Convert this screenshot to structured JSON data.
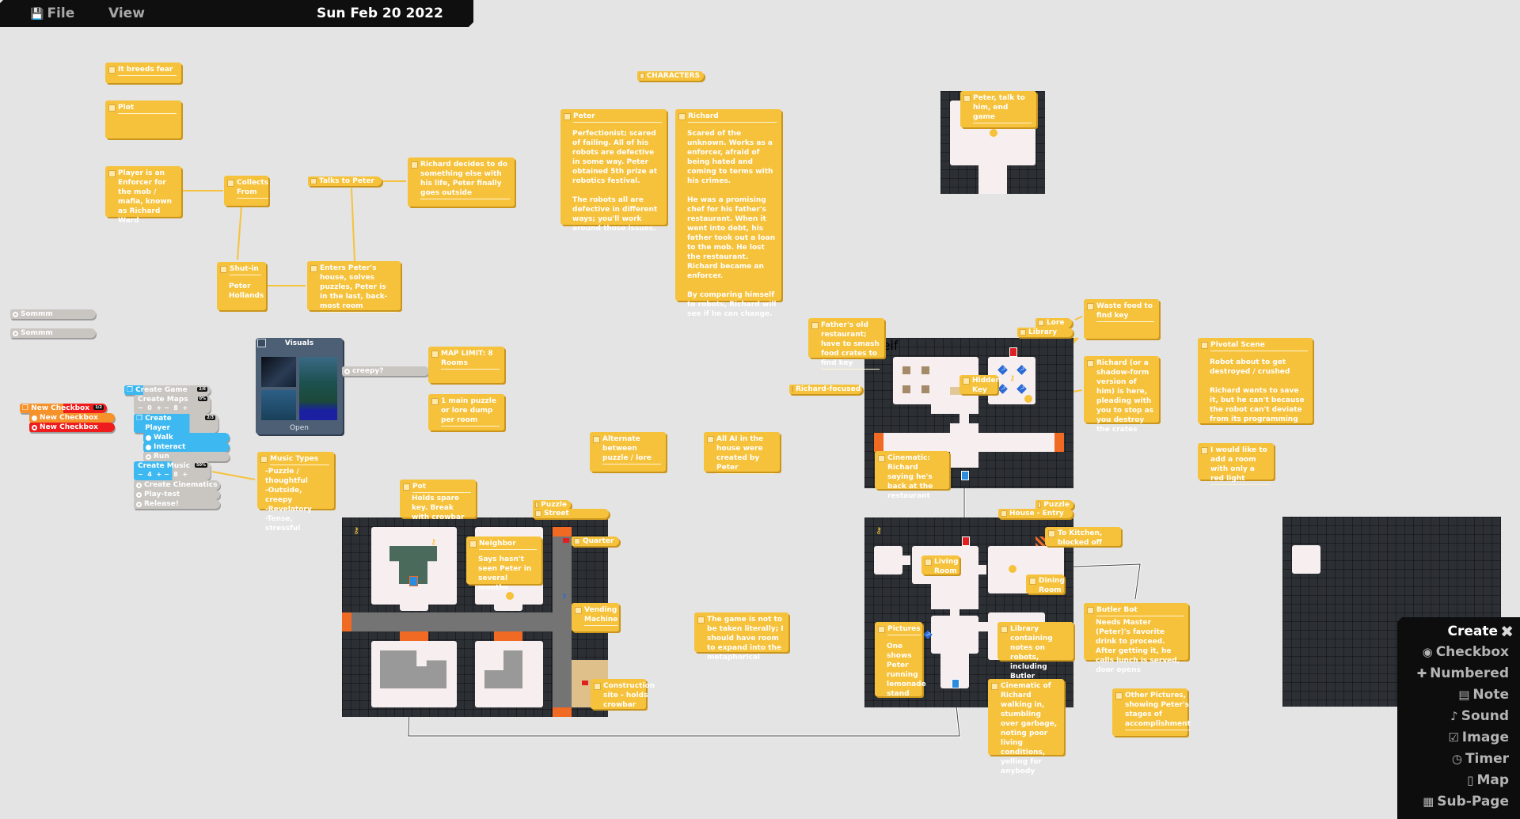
{
  "topbar": {
    "file": "File",
    "view": "View",
    "date": "Sun Feb 20 2022",
    "file_icon": "save-icon"
  },
  "notes": {
    "breeds": {
      "title": "It breeds fear"
    },
    "plot": {
      "title": "Plot"
    },
    "player": {
      "title": "Player is an Enforcer for the mob / mafia, known as Richard Ward"
    },
    "collects": {
      "title": "Collects From"
    },
    "shutin": {
      "title": "Shut-in",
      "body": "Peter Hollands"
    },
    "enters": {
      "title": "Enters Peter's house, solves puzzles, Peter is in the last, back-most room"
    },
    "talks": {
      "title": "Talks to Peter"
    },
    "decides": {
      "title": "Richard decides to do something else with his life, Peter finally goes outside"
    },
    "characters": {
      "title": "CHARACTERS"
    },
    "peter": {
      "title": "Peter",
      "body": "Perfectionist; scared of failing. All of his robots are defective in some way. Peter obtained 5th prize at robotics festival.\n\nThe robots all are defective in different ways; you'll work around those issues."
    },
    "richard": {
      "title": "Richard",
      "body": "Scared of the unknown. Works as a enforcer, afraid of being hated and coming to terms with his crimes.\n\nHe was a promising chef for his father's restaurant. When it went into debt, his father took out a loan to the mob. He lost the restaurant. Richard became an enforcer.\n\nBy comparing himself to robots, Richard will see if he can change."
    },
    "maplimit": {
      "title": "MAP LIMIT:  8 Rooms"
    },
    "onepuzzle": {
      "title": "1 main puzzle or lore dump per room"
    },
    "music": {
      "title": "Music Types",
      "body": "-Puzzle / thoughtful\n-Outside, creepy\n-Revelatory\n-Tense, stressful"
    },
    "alternate": {
      "title": "Alternate between puzzle / lore"
    },
    "allai": {
      "title": "All AI in the house were created by Peter"
    },
    "literal": {
      "title": "The game is not to be taken literally; I should have room to expand into the metaphorical"
    },
    "pot": {
      "title": "Pot",
      "body": "Holds spare key. Break with crowbar"
    },
    "neighbor": {
      "title": "Neighbor",
      "body": "Says hasn't seen Peter in several months"
    },
    "quarter": {
      "title": "Quarter"
    },
    "vending": {
      "title": "Vending Machine"
    },
    "construction": {
      "title": "Construction site - holds crowbar"
    },
    "puzzle1": {
      "title": "Puzzle"
    },
    "street": {
      "title": "Street"
    },
    "peterend": {
      "title": "Peter, talk to him, end game"
    },
    "fathers": {
      "title": "Father's old restaurant; have to smash food crates to find key"
    },
    "richfocused": {
      "title": "Richard-focused"
    },
    "lore": {
      "title": "Lore"
    },
    "library1": {
      "title": "Library"
    },
    "hiddenkey": {
      "title": "Hidden Key"
    },
    "waste": {
      "title": "Waste food to find key"
    },
    "pleading": {
      "title": "Richard (or a shadow-form version of him) is here, pleading with you to stop as you destroy the crates"
    },
    "cinematic1": {
      "title": "Cinematic: Richard saying he's back at the restaurant"
    },
    "pivotal": {
      "title": "Pivotal Scene",
      "body": "Robot about to get destroyed / crushed\n\nRichard wants to save it, but he can't because the robot can't deviate from its programming"
    },
    "redlight": {
      "title": "I would like to add a room with only a red light"
    },
    "puzzle2": {
      "title": "Puzzle"
    },
    "houseentry": {
      "title": "House - Entry"
    },
    "kitchen": {
      "title": "To Kitchen, blocked off"
    },
    "living": {
      "title": "Living Room"
    },
    "dining": {
      "title": "Dining Room"
    },
    "butler": {
      "title": "Butler Bot",
      "body": "Needs Master (Peter)'s favorite drink to proceed. After getting it, he calls lunch is served, door opens"
    },
    "pictures": {
      "title": "Pictures",
      "body": "One shows Peter running lemonade stand"
    },
    "library2": {
      "title": "Library containing notes on robots, including Butler"
    },
    "cinematic2": {
      "title": "Cinematic of Richard walking in, stumbling over garbage, noting poor living conditions, yelling for anybody"
    },
    "otherpics": {
      "title": "Other Pictures, showing Peter's stages of accomplishment"
    }
  },
  "checkboxes": {
    "sommm1": "Sommm",
    "sommm2": "Sommm",
    "creepy": "creepy?",
    "newcb": {
      "label": "New Checkbox",
      "badge": "1/2",
      "children": [
        "New Checkbox",
        "New Checkbox"
      ]
    },
    "game": {
      "label": "Create Game",
      "badge": "2/6"
    },
    "maps": {
      "label": "Create Maps",
      "badge": "0%",
      "value": "0",
      "max": "8"
    },
    "player": {
      "label": "Create Player Mechanics",
      "badge": "2/3",
      "children": [
        "Walk",
        "Interact",
        "Run"
      ]
    },
    "musicc": {
      "label": "Create Music",
      "badge": "50%",
      "value": "4",
      "max": "8"
    },
    "cinematics": "Create Cinematics",
    "playtest": "Play-test",
    "release": "Release!"
  },
  "visuals": {
    "title": "Visuals",
    "open": "Open"
  },
  "create_panel": {
    "title": "Create",
    "items": [
      {
        "label": "Checkbox",
        "icon": "checkbox-icon"
      },
      {
        "label": "Numbered",
        "icon": "plus-icon"
      },
      {
        "label": "Note",
        "icon": "note-icon"
      },
      {
        "label": "Sound",
        "icon": "music-note-icon"
      },
      {
        "label": "Image",
        "icon": "image-icon"
      },
      {
        "label": "Timer",
        "icon": "clock-icon"
      },
      {
        "label": "Map",
        "icon": "map-icon"
      },
      {
        "label": "Sub-Page",
        "icon": "subpage-icon"
      }
    ]
  },
  "colors": {
    "note": "#f6c23c",
    "canvas": "#e4e4e4",
    "map_bg": "#2c3035",
    "room": "#f7efef",
    "blue_checkbox": "#3db8f0",
    "orange": "#f5922a",
    "red": "#ee1c1c",
    "door_orange": "#f06a24"
  }
}
